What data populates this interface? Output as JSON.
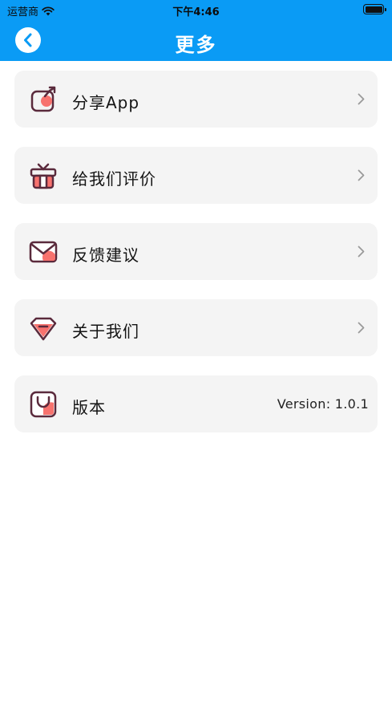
{
  "status_bar": {
    "carrier": "运营商",
    "time": "下午4:46",
    "icons": [
      "wifi-icon",
      "battery-icon"
    ]
  },
  "nav": {
    "title": "更多",
    "back_icon": "chevron-left-icon",
    "color": "#0a9bf5"
  },
  "menu": {
    "items": [
      {
        "label": "分享App",
        "icon": "share-icon"
      },
      {
        "label": "给我们评价",
        "icon": "gift-icon"
      },
      {
        "label": "反馈建议",
        "icon": "mail-icon"
      },
      {
        "label": "关于我们",
        "icon": "diamond-icon"
      },
      {
        "label": "版本",
        "icon": "bag-icon",
        "value": "Version: 1.0.1"
      }
    ],
    "accent_color": "#f7726e",
    "outline_color": "#5a2a3c"
  }
}
